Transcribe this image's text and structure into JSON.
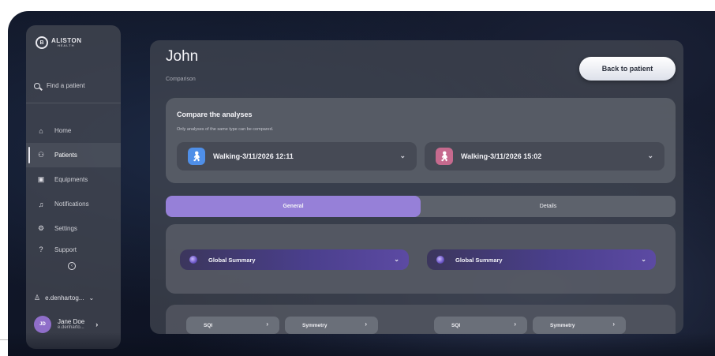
{
  "sidebar": {
    "logo": {
      "mark": "B",
      "name": "ALISTON",
      "sub": "HEALTH"
    },
    "search_label": "Find a patient",
    "items": [
      {
        "label": "Home",
        "icon": "home-icon",
        "glyph": "⌂",
        "active": false
      },
      {
        "label": "Patients",
        "icon": "patients-icon",
        "glyph": "⚇",
        "active": true
      },
      {
        "label": "Equipments",
        "icon": "equipment-icon",
        "glyph": "▣",
        "active": false
      },
      {
        "label": "Notifications",
        "icon": "bell-icon",
        "glyph": "♫",
        "active": false
      },
      {
        "label": "Settings",
        "icon": "gear-icon",
        "glyph": "⚙",
        "active": false
      },
      {
        "label": "Support",
        "icon": "help-icon",
        "glyph": "?",
        "active": false
      }
    ],
    "collapse_glyph": "‹",
    "account_label": "e.denhartog...",
    "account_chevron": "⌄",
    "user": {
      "initials": "JD",
      "name": "Jane Doe",
      "email": "e.denharto..."
    }
  },
  "header": {
    "title": "John",
    "subtitle": "Comparison",
    "back_button": "Back to patient"
  },
  "compare": {
    "title": "Compare the analyses",
    "subtitle": "Only analyses of the same type can be compared.",
    "left": {
      "label": "Walking-3/11/2026 12:11",
      "color": "#4f8fe8"
    },
    "right": {
      "label": "Walking-3/11/2026 15:02",
      "color": "#c66a8e"
    },
    "chevron": "⌄"
  },
  "tabs": [
    {
      "label": "General",
      "active": true
    },
    {
      "label": "Details",
      "active": false
    }
  ],
  "summary": {
    "left_label": "Global Summary",
    "right_label": "Global Summary",
    "chevron": "⌄"
  },
  "metrics": [
    {
      "label": "SQI"
    },
    {
      "label": "Symmetry"
    },
    {
      "label": "SQI"
    },
    {
      "label": "Symmetry"
    }
  ],
  "metric_chevron": "›",
  "colors": {
    "accent": "#9680d8",
    "walk_left": "#4f8fe8",
    "walk_right": "#c66a8e"
  }
}
